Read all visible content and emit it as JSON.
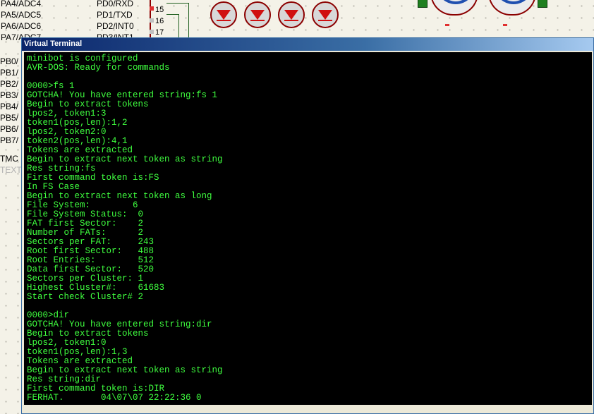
{
  "schematic": {
    "left_pins": [
      "PA4/ADC4",
      "PA5/ADC5",
      "PA6/ADC6",
      "PA7/ADC7",
      "PB0/",
      "PB1/",
      "PB2/",
      "PB3/",
      "PB4/",
      "PB5/",
      "PB6/",
      "PB7/",
      "TMC",
      "TEXT"
    ],
    "right_pins": [
      "PD0/RXD",
      "PD1/TXD",
      "PD2/INT0",
      "PD3/INT1"
    ],
    "pin_numbers": [
      "15",
      "16",
      "17"
    ]
  },
  "window": {
    "title": "Virtual Terminal"
  },
  "terminal": {
    "lines": [
      "minibot is configured",
      "AVR-DOS: Ready for commands",
      "",
      "0000>fs 1",
      "GOTCHA! You have entered string:fs 1",
      "Begin to extract tokens",
      "lpos2, token1:3",
      "token1(pos,len):1,2",
      "lpos2, token2:0",
      "token2(pos,len):4,1",
      "Tokens are extracted",
      "Begin to extract next token as string",
      "Res string:fs",
      "First command token is:FS",
      "In FS Case",
      "Begin to extract next token as long",
      "File System:        6",
      "File System Status:  0",
      "FAT first Sector:    2",
      "Number of FATs:      2",
      "Sectors per FAT:     243",
      "Root first Sector:   488",
      "Root Entries:        512",
      "Data first Sector:   520",
      "Sectors per Cluster: 1",
      "Highest Cluster#:    61683",
      "Start check Cluster# 2",
      "",
      "0000>dir",
      "GOTCHA! You have entered string:dir",
      "Begin to extract tokens",
      "lpos2, token1:0",
      "token1(pos,len):1,3",
      "Tokens are extracted",
      "Begin to extract next token as string",
      "Res string:dir",
      "First command token is:DIR",
      "FERHAT.       04\\07\\07 22:22:36 0"
    ]
  }
}
